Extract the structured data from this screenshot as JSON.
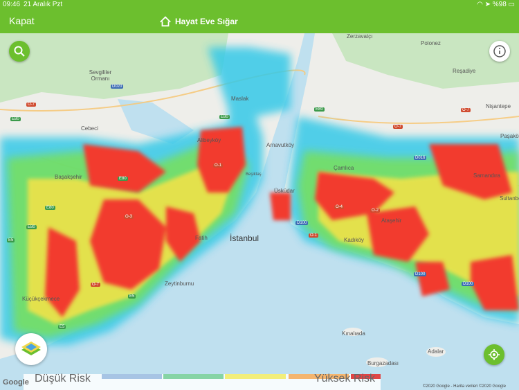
{
  "status_bar": {
    "time": "09:46",
    "date": "21 Aralık Pzt",
    "battery": "%98"
  },
  "nav": {
    "close_label": "Kapat",
    "brand_title": "Hayat Eve Sığar"
  },
  "map_labels": [
    "Zerzavatçı",
    "Polonez",
    "Reşadiye",
    "Sevgililer Ormanı",
    "Maslak",
    "Nişantepe",
    "Paşakö",
    "Cebeci",
    "Alibeyköy",
    "Arnavutköy",
    "Çamlıca",
    "Başakşehir",
    "Beşiktaş",
    "Üsküdar",
    "Samandıra",
    "Sultanbeyli",
    "Fatih",
    "Ataşehir",
    "Kadıköy",
    "Küçükçekmece",
    "Zeytinburnu",
    "Kınalıada",
    "Burgazadası",
    "Adalar"
  ],
  "big_label": "İstanbul",
  "road_shields": [
    "D020",
    "O-7",
    "E80",
    "E80",
    "E80",
    "O-1",
    "O-3",
    "O-7",
    "E5",
    "E80",
    "E5",
    "O-7",
    "D016",
    "E80",
    "O-7",
    "D100",
    "O-1",
    "O-2",
    "O-4",
    "D100",
    "D100",
    "E80",
    "E5"
  ],
  "legend": {
    "low": "Düşük Risk",
    "high": "Yüksek Risk",
    "colors": [
      "#a7c4e4",
      "#86d4a5",
      "#f2ee7a",
      "#f4b56e",
      "#e04545"
    ]
  },
  "footer": {
    "google": "Google",
    "attribution": "©2020 Google - Harita verileri ©2020 Google"
  }
}
